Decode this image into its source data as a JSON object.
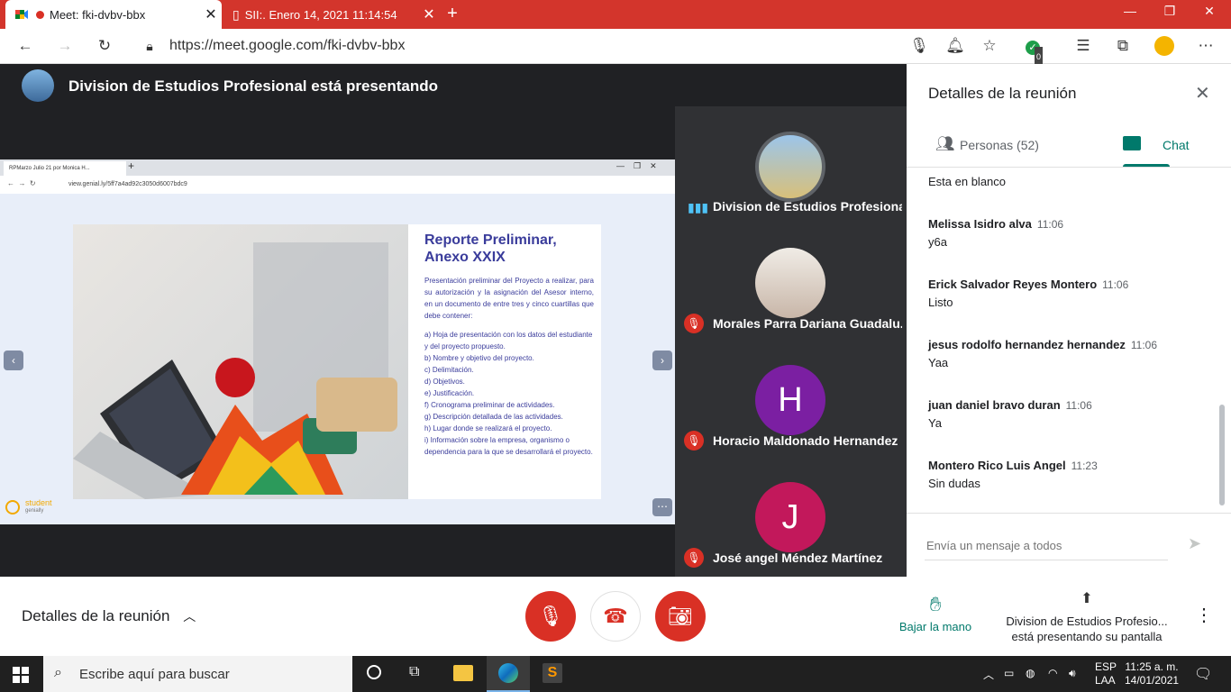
{
  "browser": {
    "tabs": [
      {
        "label": "Meet: fki-dvbv-bbx"
      },
      {
        "label": "SII:. Enero 14, 2021 11:14:54"
      }
    ],
    "url": "https://meet.google.com/fki-dvbv-bbx",
    "extension_badge": "0"
  },
  "meet": {
    "presenting_title": "Division de Estudios Profesional está presentando",
    "slide": {
      "browser_tab": "RPMarzo Julio 21 por Monica H...",
      "url": "view.genial.ly/5ff7a4ad92c3050d6007bdc9",
      "title_line1": "Reporte Preliminar,",
      "title_line2": "Anexo XXIX",
      "intro": "Presentación preliminar del Proyecto a realizar, para su autorización y la asignación del Asesor interno, en un documento de entre tres y cinco cuartillas que debe contener:",
      "items": [
        "a) Hoja de presentación con los datos del estudiante y del proyecto propuesto.",
        "b) Nombre y objetivo del proyecto.",
        "c) Delimitación.",
        "d) Objetivos.",
        "e) Justificación.",
        "f) Cronograma preliminar de actividades.",
        "g) Descripción detallada de las actividades.",
        "h) Lugar donde se realizará el proyecto.",
        "i) Información sobre la empresa, organismo o dependencia para la que se desarrollará el proyecto."
      ],
      "brand": "student",
      "brand_sub": "genially"
    },
    "participants": [
      {
        "name": "Division de Estudios Profesional",
        "muted": false
      },
      {
        "name": "Morales Parra Dariana Guadalu...",
        "muted": true
      },
      {
        "name": "Horacio Maldonado Hernandez",
        "initial": "H",
        "color": "#7b1fa2",
        "muted": true
      },
      {
        "name": "José angel Méndez Martínez",
        "initial": "J",
        "color": "#c2185b",
        "muted": true
      }
    ],
    "panel": {
      "title": "Detalles de la reunión",
      "tab_people": "Personas (52)",
      "tab_chat": "Chat",
      "messages": [
        {
          "sender": "",
          "time": "",
          "text": "Esta en blanco"
        },
        {
          "sender": "Melissa Isidro alva",
          "time": "11:06",
          "text": "y6a"
        },
        {
          "sender": "Erick Salvador Reyes Montero",
          "time": "11:06",
          "text": "Listo"
        },
        {
          "sender": "jesus rodolfo hernandez hernandez",
          "time": "11:06",
          "text": "Yaa"
        },
        {
          "sender": "juan daniel bravo duran",
          "time": "11:06",
          "text": "Ya"
        },
        {
          "sender": "Montero Rico Luis Angel",
          "time": "11:23",
          "text": "Sin dudas"
        }
      ],
      "input_placeholder": "Envía un mensaje a todos"
    },
    "bottom": {
      "details_label": "Detalles de la reunión",
      "raise_hand": "Bajar la mano",
      "presenting_line1": "Division de Estudios Profesio...",
      "presenting_line2": "está presentando su pantalla"
    }
  },
  "taskbar": {
    "search_placeholder": "Escribe aquí para buscar",
    "lang1": "ESP",
    "lang2": "LAA",
    "time": "11:25 a. m.",
    "date": "14/01/2021"
  },
  "colors": {
    "chrome_red": "#d3352c",
    "meet_red": "#d93025",
    "meet_green": "#00796b"
  }
}
